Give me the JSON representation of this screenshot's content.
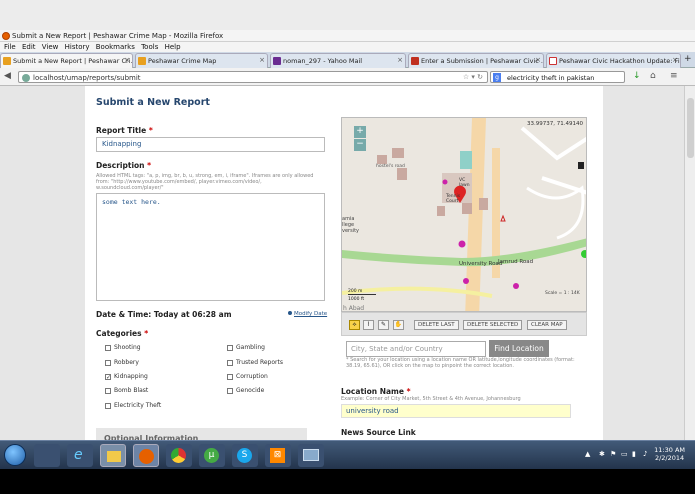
{
  "window": {
    "title": "Submit a New Report | Peshawar Crime Map - Mozilla Firefox"
  },
  "menu": [
    "File",
    "Edit",
    "View",
    "History",
    "Bookmarks",
    "Tools",
    "Help"
  ],
  "tabs": [
    {
      "label": "Submit a New Report | Peshawar Cri...",
      "icon": "ushahidi-icon",
      "color": "#e8a020",
      "active": true
    },
    {
      "label": "Peshawar Crime Map",
      "icon": "ushahidi-icon",
      "color": "#e8a020",
      "active": false
    },
    {
      "label": "noman_297 - Yahoo Mail",
      "icon": "yahoo-mail-icon",
      "color": "#6a2c91",
      "active": false
    },
    {
      "label": "Enter a Submission | Peshawar Civic ...",
      "icon": "site-icon",
      "color": "#c03020",
      "active": false
    },
    {
      "label": "Peshawar Civic Hackathon Update: Fi...",
      "icon": "gmail-icon",
      "color": "#d03030",
      "active": false
    }
  ],
  "nav": {
    "url": "localhost/umap/reports/submit",
    "search": "electricity theft in pakistan"
  },
  "form": {
    "heading": "Submit a New Report",
    "title_label": "Report Title",
    "title_value": "Kidnapping",
    "desc_label": "Description",
    "desc_hint": "Allowed HTML tags: \"a, p, img, br, b, u, strong, em, i, iframe\". Iframes are only allowed from: \"http://www.youtube.com/embed/, player.vimeo.com/video/, w.soundcloud.com/player/\"",
    "desc_value": "some text here.",
    "date_label": "Date & Time: Today at 06:28 am",
    "modify_date": "Modify Date",
    "categories_label": "Categories",
    "categories": [
      {
        "label": "Shooting",
        "checked": false
      },
      {
        "label": "Robbery",
        "checked": false
      },
      {
        "label": "Kidnapping",
        "checked": true
      },
      {
        "label": "Bomb Blast",
        "checked": false
      },
      {
        "label": "Electricity Theft",
        "checked": false
      },
      {
        "label": "Gambling",
        "checked": false
      },
      {
        "label": "Trusted Reports",
        "checked": false
      },
      {
        "label": "Corruption",
        "checked": false
      },
      {
        "label": "Genocide",
        "checked": false
      }
    ],
    "optional_label": "Optional Information"
  },
  "map": {
    "coords": "33.99737, 71.49140",
    "road_label": "University Road",
    "road_label2": "Jamrud Road",
    "place_hostel": "hostel's road",
    "place_vc": "VC lawn",
    "place_tennis": "Tennis Court",
    "place_college": "amia llege versity",
    "place_abad": "h Abad",
    "scale_m": "200 m",
    "scale_ft": "1000 ft",
    "scale_text": "Scale = 1 : 14K",
    "buttons": [
      "DELETE LAST",
      "DELETE SELECTED",
      "CLEAR MAP"
    ],
    "location_placeholder": "City, State and/or Country",
    "find_button": "Find Location",
    "search_hint": "* Search for your location using a location name OR latitude,longitude coordinates (format: 38.19, 65.61), OR click on the map to pinpoint the correct location."
  },
  "location": {
    "name_label": "Location Name",
    "name_example": "Example: Corner of City Market, 5th Street & 4th Avenue, Johannesburg",
    "name_value": "university road",
    "news_label": "News Source Link"
  },
  "taskbar": {
    "time": "11:30 AM",
    "date": "2/2/2014"
  }
}
